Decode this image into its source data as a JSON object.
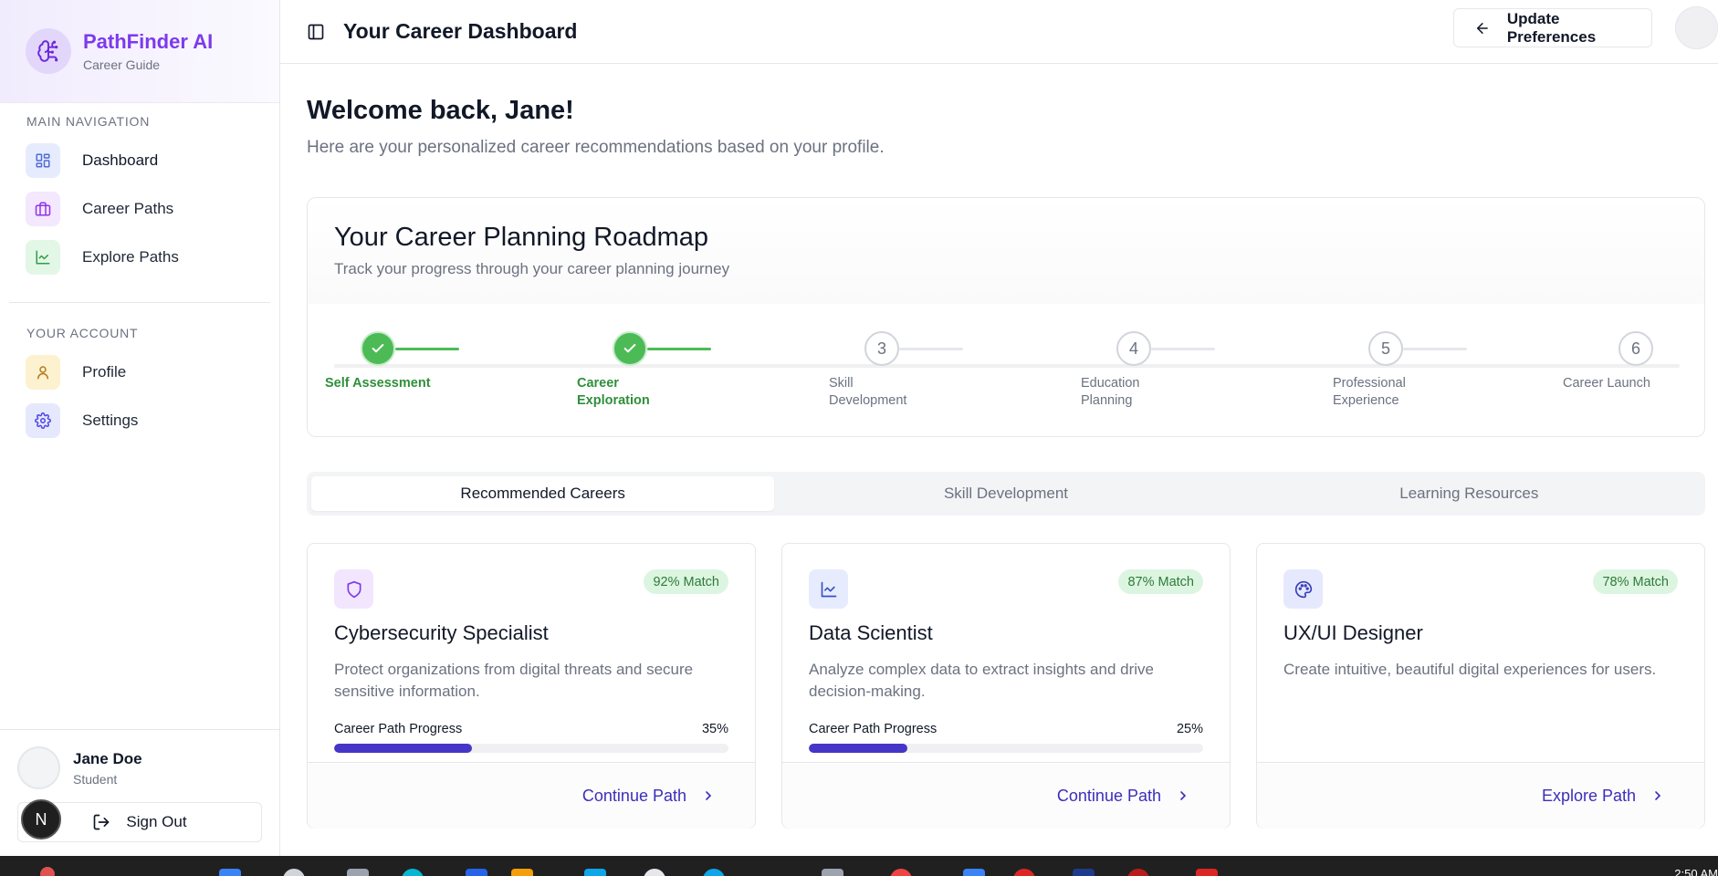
{
  "app": {
    "name": "PathFinder AI",
    "subtitle": "Career Guide"
  },
  "sidebar": {
    "main_heading": "MAIN NAVIGATION",
    "main_items": [
      {
        "label": "Dashboard",
        "icon": "grid-icon"
      },
      {
        "label": "Career Paths",
        "icon": "briefcase-icon"
      },
      {
        "label": "Explore Paths",
        "icon": "line-chart-icon"
      }
    ],
    "account_heading": "YOUR ACCOUNT",
    "account_items": [
      {
        "label": "Profile",
        "icon": "user-icon"
      },
      {
        "label": "Settings",
        "icon": "gear-icon"
      }
    ],
    "user": {
      "name": "Jane Doe",
      "role": "Student"
    },
    "sign_out": "Sign Out",
    "badge": "N"
  },
  "header": {
    "title": "Your Career Dashboard",
    "update_button": "Update Preferences"
  },
  "welcome": {
    "title": "Welcome back, Jane!",
    "subtitle": "Here are your personalized career recommendations based on your profile."
  },
  "roadmap": {
    "title": "Your Career Planning Roadmap",
    "subtitle": "Track your progress through your career planning journey",
    "steps": [
      {
        "number": "1",
        "label": "Self Assessment",
        "done": true
      },
      {
        "number": "2",
        "label": "Career Exploration",
        "done": true
      },
      {
        "number": "3",
        "label": "Skill Development",
        "done": false
      },
      {
        "number": "4",
        "label": "Education Planning",
        "done": false
      },
      {
        "number": "5",
        "label": "Professional Experience",
        "done": false
      },
      {
        "number": "6",
        "label": "Career Launch",
        "done": false
      }
    ]
  },
  "tabs": [
    "Recommended Careers",
    "Skill Development",
    "Learning Resources"
  ],
  "cards": [
    {
      "title": "Cybersecurity Specialist",
      "match": "92% Match",
      "description": "Protect organizations from digital threats and secure sensitive information.",
      "progress_label": "Career Path Progress",
      "progress_text": "35%",
      "progress": 0.35,
      "link": "Continue Path",
      "icon": "shield-icon"
    },
    {
      "title": "Data Scientist",
      "match": "87% Match",
      "description": "Analyze complex data to extract insights and drive decision-making.",
      "progress_label": "Career Path Progress",
      "progress_text": "25%",
      "progress": 0.25,
      "link": "Continue Path",
      "icon": "line-chart-icon"
    },
    {
      "title": "UX/UI Designer",
      "match": "78% Match",
      "description": "Create intuitive, beautiful digital experiences for users.",
      "link": "Explore Path",
      "icon": "palette-icon"
    }
  ],
  "taskbar": {
    "time": "2:50 AM"
  },
  "colors": {
    "brand": "#7c3aed",
    "accent": "#4636c7",
    "success": "#4cbb56"
  }
}
